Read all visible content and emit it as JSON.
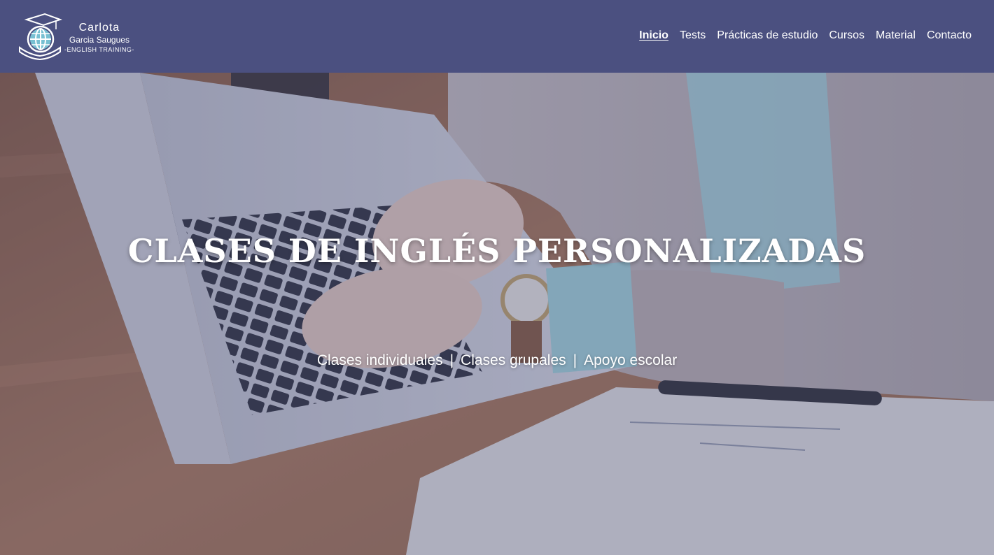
{
  "brand": {
    "name": "Carlota",
    "surname": "Garcia Saugues",
    "tagline": "-ENGLISH TRAINING-"
  },
  "nav": {
    "items": [
      {
        "label": "Inicio",
        "active": true
      },
      {
        "label": "Tests",
        "active": false
      },
      {
        "label": "Prácticas de estudio",
        "active": false
      },
      {
        "label": "Cursos",
        "active": false
      },
      {
        "label": "Material",
        "active": false
      },
      {
        "label": "Contacto",
        "active": false
      }
    ]
  },
  "hero": {
    "title": "CLASES DE INGLÉS PERSONALIZADAS",
    "services": [
      "Clases individuales",
      "Clases grupales",
      "Apoyo escolar"
    ],
    "separator": "|"
  },
  "colors": {
    "header_bg": "#4b5080",
    "text": "#ffffff",
    "overlay": "#484c78"
  }
}
